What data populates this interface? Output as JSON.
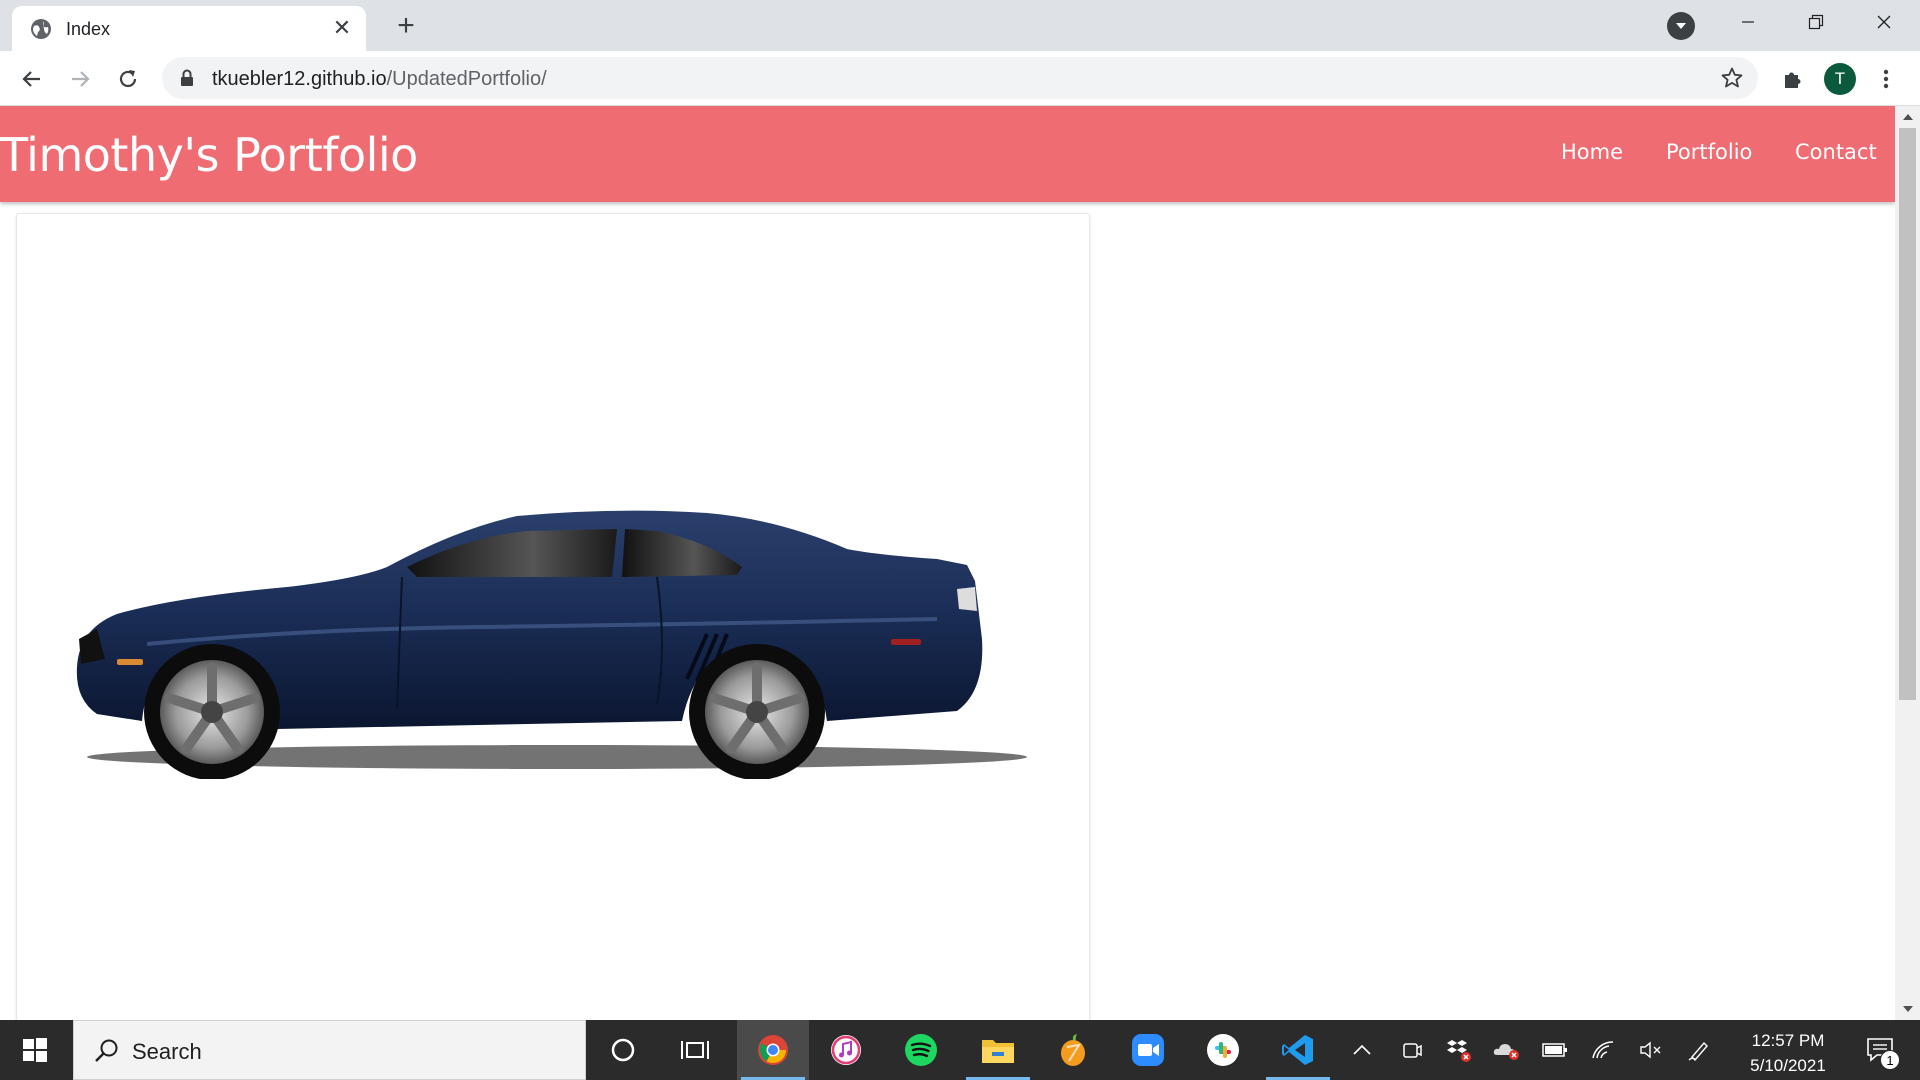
{
  "browser": {
    "tab_title": "Index",
    "tab_close": "✕",
    "new_tab": "+",
    "url_domain": "tkuebler12.github.io",
    "url_path": "/UpdatedPortfolio/",
    "profile_initial": "T",
    "icons": [
      "globe-icon",
      "tab-search-icon",
      "minimize-icon",
      "restore-icon",
      "close-window-icon",
      "back-icon",
      "forward-icon",
      "reload-icon",
      "lock-icon",
      "bookmark-star-icon",
      "extensions-icon",
      "menu-icon"
    ]
  },
  "site": {
    "brand": "Timothy's Portfolio",
    "nav": [
      "Home",
      "Portfolio",
      "Contact"
    ],
    "nav_bg": "#ef6c73",
    "card_image": "blue-sports-car"
  },
  "taskbar": {
    "search_placeholder": "Search",
    "apps": [
      "cortana-icon",
      "task-view-icon",
      "chrome-icon",
      "itunes-icon",
      "spotify-icon",
      "file-explorer-icon",
      "fl-studio-icon",
      "zoom-icon",
      "slack-icon",
      "vscode-icon"
    ],
    "time": "12:57 PM",
    "date": "5/10/2021",
    "notification_count": "1"
  }
}
